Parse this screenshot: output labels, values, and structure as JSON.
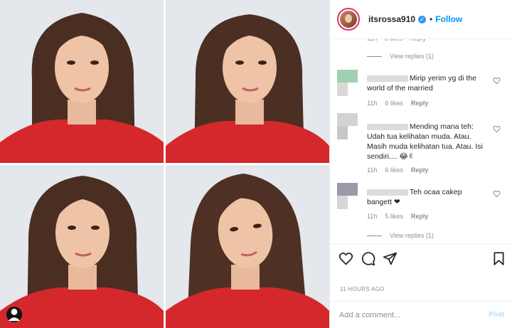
{
  "post": {
    "username": "itsrossa910",
    "follow_label": "Follow",
    "separator": "•",
    "timestamp": "11 HOURS AGO"
  },
  "comments_panel": {
    "partial_top_meta": "11h    5 likes    Reply",
    "view_replies_1": "View replies (1)",
    "view_replies_2": "View replies (1)",
    "comments": [
      {
        "text": "Mirip yerim yg di the world of the married",
        "time": "11h",
        "likes": "6 likes",
        "reply": "Reply"
      },
      {
        "text": "Mending mana teh: Udah tua kelihatan muda. Atau. Masih muda kelihatan tua. Atau. Isi sendiri.... 😂✌",
        "time": "11h",
        "likes": "6 likes",
        "reply": "Reply"
      },
      {
        "text": "Teh ocaa cakep bangett ❤",
        "time": "11h",
        "likes": "5 likes",
        "reply": "Reply"
      }
    ]
  },
  "composer": {
    "placeholder": "Add a comment...",
    "post_label": "Post"
  },
  "icons": [
    "like-icon",
    "comment-icon",
    "share-icon",
    "save-icon",
    "heart-icon",
    "verified-badge-icon",
    "user-tag-icon"
  ],
  "colors": {
    "follow_blue": "#0095f6",
    "muted_text": "#8e8e8e",
    "dress_red": "#d4282c",
    "verified_blue": "#3897f0"
  }
}
